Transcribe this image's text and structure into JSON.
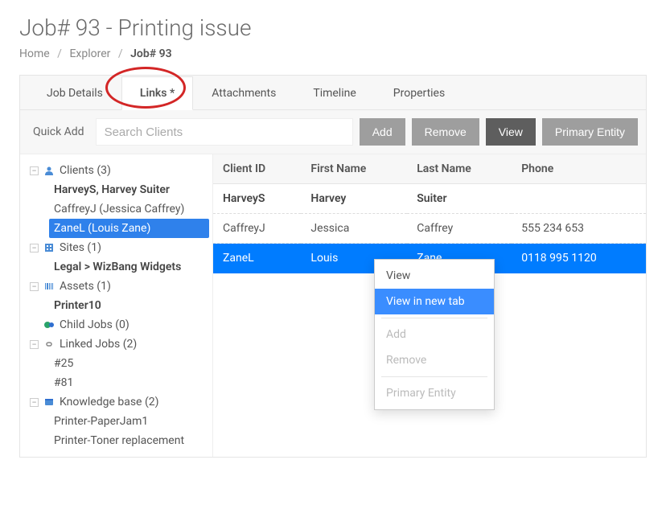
{
  "title": "Job# 93 - Printing issue",
  "breadcrumb": {
    "home": "Home",
    "explorer": "Explorer",
    "current": "Job# 93"
  },
  "tabs": {
    "job_details": "Job Details",
    "links": "Links *",
    "attachments": "Attachments",
    "timeline": "Timeline",
    "properties": "Properties",
    "active": "links"
  },
  "toolbar": {
    "quick_add": "Quick Add",
    "search_placeholder": "Search Clients",
    "add": "Add",
    "remove": "Remove",
    "view": "View",
    "primary_entity": "Primary Entity"
  },
  "tree": {
    "clients": {
      "label": "Clients (3)",
      "items": [
        {
          "label": "HarveyS, Harvey Suiter",
          "bold": true
        },
        {
          "label": "CaffreyJ (Jessica Caffrey)"
        },
        {
          "label": "ZaneL (Louis Zane)",
          "selected": true
        }
      ]
    },
    "sites": {
      "label": "Sites (1)",
      "items": [
        {
          "label": "Legal > WizBang Widgets",
          "bold": true
        }
      ]
    },
    "assets": {
      "label": "Assets (1)",
      "items": [
        {
          "label": "Printer10",
          "bold": true
        }
      ]
    },
    "child_jobs": {
      "label": "Child Jobs (0)",
      "items": []
    },
    "linked_jobs": {
      "label": "Linked Jobs (2)",
      "items": [
        {
          "label": "#25"
        },
        {
          "label": "#81"
        }
      ]
    },
    "knowledge_base": {
      "label": "Knowledge base (2)",
      "items": [
        {
          "label": "Printer-PaperJam1"
        },
        {
          "label": "Printer-Toner replacement"
        }
      ]
    }
  },
  "table": {
    "columns": {
      "client_id": "Client ID",
      "first_name": "First Name",
      "last_name": "Last Name",
      "phone": "Phone"
    },
    "rows": [
      {
        "client_id": "HarveyS",
        "first_name": "Harvey",
        "last_name": "Suiter",
        "phone": "",
        "bold": true
      },
      {
        "client_id": "CaffreyJ",
        "first_name": "Jessica",
        "last_name": "Caffrey",
        "phone": "555 234 653"
      },
      {
        "client_id": "ZaneL",
        "first_name": "Louis",
        "last_name": "Zane",
        "phone": "0118 995 1120",
        "selected": true
      }
    ]
  },
  "context_menu": {
    "view": "View",
    "view_new_tab": "View in new tab",
    "add": "Add",
    "remove": "Remove",
    "primary_entity": "Primary Entity"
  }
}
